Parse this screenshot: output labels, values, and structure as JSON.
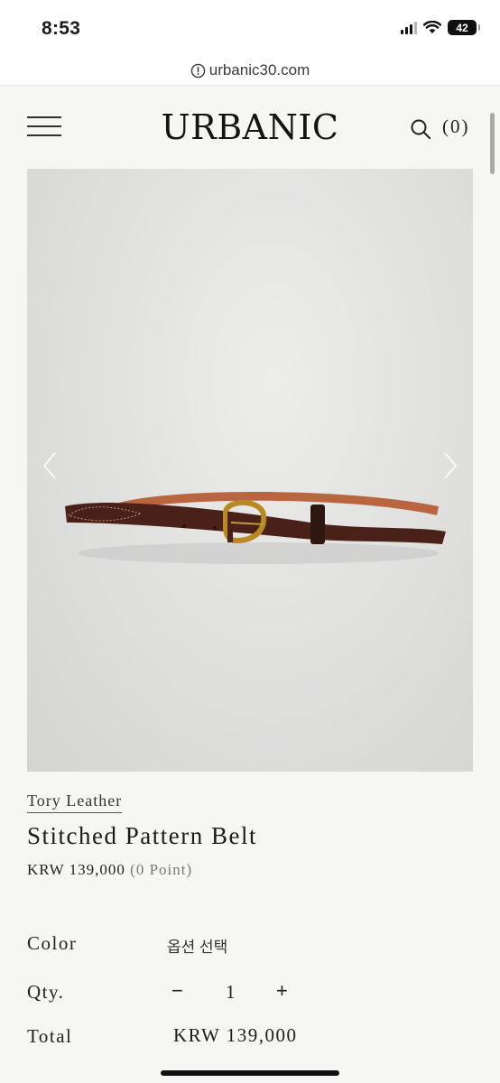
{
  "status_bar": {
    "time": "8:53",
    "battery": "42",
    "icons": [
      "signal-icon",
      "wifi-icon",
      "battery-icon"
    ]
  },
  "browser": {
    "url": "urbanic30.com",
    "url_icon": "info-icon"
  },
  "header": {
    "logo": "URBANIC",
    "menu_icon": "hamburger-menu-icon",
    "search_icon": "search-icon",
    "cart_count": "(0)"
  },
  "gallery": {
    "prev_icon": "chevron-left-icon",
    "next_icon": "chevron-right-icon",
    "image_subject": "brown leather belt with brass buckle"
  },
  "product": {
    "brand": "Tory Leather",
    "title": "Stitched Pattern Belt",
    "price": "KRW 139,000",
    "points": "(0 Point)"
  },
  "options": {
    "color_label": "Color",
    "color_value": "옵션 선택",
    "qty_label": "Qty.",
    "qty_minus": "−",
    "qty_value": "1",
    "qty_plus": "+",
    "total_label": "Total",
    "total_value": "KRW 139,000"
  },
  "colors": {
    "page_background": "#f6f6f4",
    "text": "#1d1d1d",
    "belt_leather": "#4a2119",
    "buckle": "#b98a22"
  }
}
